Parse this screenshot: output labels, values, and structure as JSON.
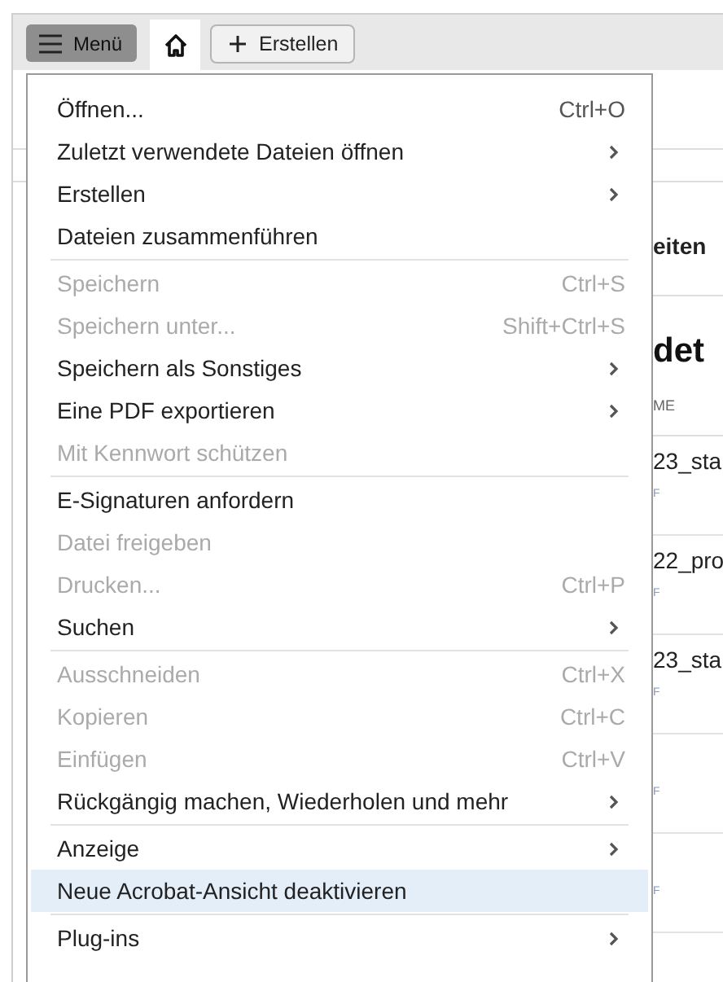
{
  "toolbar": {
    "menu_button": "Menü",
    "home_tab": {
      "selected": true
    },
    "create_button": "Erstellen"
  },
  "background": {
    "section_title": "eiten",
    "heading": "det",
    "column_header": "ME",
    "rows": [
      {
        "name": "23_sta",
        "type": "F"
      },
      {
        "name": "22_pro",
        "type": "F"
      },
      {
        "name": "23_sta",
        "type": "F"
      },
      {
        "type": "F"
      },
      {
        "type": "F"
      }
    ]
  },
  "menu": {
    "groups": [
      [
        {
          "label": "Öffnen...",
          "shortcut": "Ctrl+O",
          "submenu": false,
          "disabled": false,
          "highlighted": false
        },
        {
          "label": "Zuletzt verwendete Dateien öffnen",
          "submenu": true,
          "disabled": false,
          "highlighted": false
        },
        {
          "label": "Erstellen",
          "submenu": true,
          "disabled": false,
          "highlighted": false
        },
        {
          "label": "Dateien zusammenführen",
          "submenu": false,
          "disabled": false,
          "highlighted": false
        }
      ],
      [
        {
          "label": "Speichern",
          "shortcut": "Ctrl+S",
          "submenu": false,
          "disabled": true,
          "highlighted": false
        },
        {
          "label": "Speichern unter...",
          "shortcut": "Shift+Ctrl+S",
          "submenu": false,
          "disabled": true,
          "highlighted": false
        },
        {
          "label": "Speichern als Sonstiges",
          "submenu": true,
          "disabled": false,
          "highlighted": false
        },
        {
          "label": "Eine PDF exportieren",
          "submenu": true,
          "disabled": false,
          "highlighted": false
        },
        {
          "label": "Mit Kennwort schützen",
          "submenu": false,
          "disabled": true,
          "highlighted": false
        }
      ],
      [
        {
          "label": "E-Signaturen anfordern",
          "submenu": false,
          "disabled": false,
          "highlighted": false
        },
        {
          "label": "Datei freigeben",
          "submenu": false,
          "disabled": true,
          "highlighted": false
        },
        {
          "label": "Drucken...",
          "shortcut": "Ctrl+P",
          "submenu": false,
          "disabled": true,
          "highlighted": false
        },
        {
          "label": "Suchen",
          "submenu": true,
          "disabled": false,
          "highlighted": false
        }
      ],
      [
        {
          "label": "Ausschneiden",
          "shortcut": "Ctrl+X",
          "submenu": false,
          "disabled": true,
          "highlighted": false
        },
        {
          "label": "Kopieren",
          "shortcut": "Ctrl+C",
          "submenu": false,
          "disabled": true,
          "highlighted": false
        },
        {
          "label": "Einfügen",
          "shortcut": "Ctrl+V",
          "submenu": false,
          "disabled": true,
          "highlighted": false
        },
        {
          "label": "Rückgängig machen, Wiederholen und mehr",
          "submenu": true,
          "disabled": false,
          "highlighted": false
        }
      ],
      [
        {
          "label": "Anzeige",
          "submenu": true,
          "disabled": false,
          "highlighted": false
        },
        {
          "label": "Neue Acrobat-Ansicht deaktivieren",
          "submenu": false,
          "disabled": false,
          "highlighted": true
        }
      ],
      [
        {
          "label": "Plug-ins",
          "submenu": true,
          "disabled": false,
          "highlighted": false
        }
      ]
    ]
  }
}
